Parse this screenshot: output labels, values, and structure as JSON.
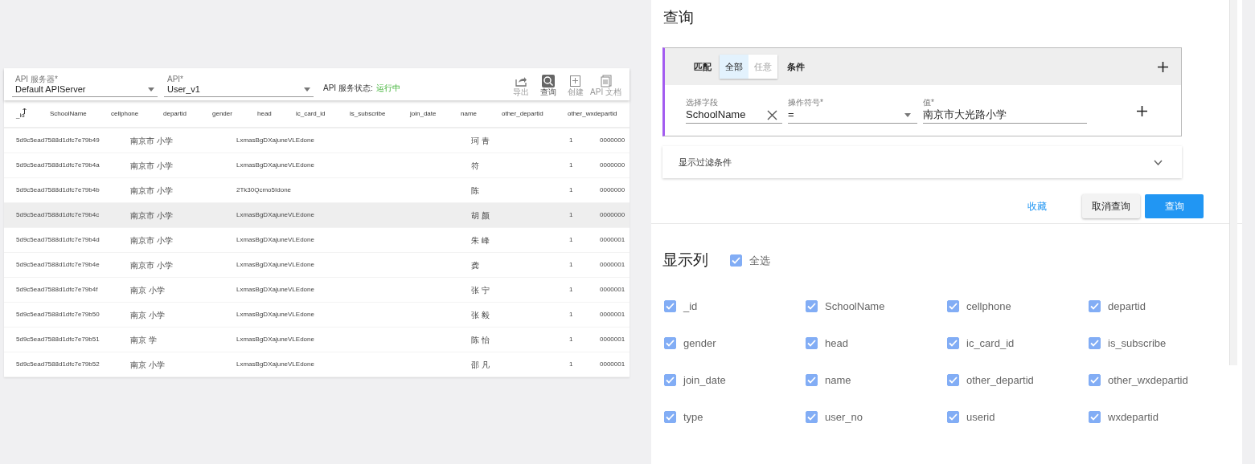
{
  "toolbar": {
    "server": {
      "label": "API 服务器*",
      "value": "Default APIServer"
    },
    "api": {
      "label": "API*",
      "value": "User_v1"
    },
    "status_label": "API 服务状态:",
    "status_value": "运行中",
    "actions": [
      {
        "label": "导出",
        "kind": "export",
        "selected": false
      },
      {
        "label": "查询",
        "kind": "search",
        "selected": true
      },
      {
        "label": "创建",
        "kind": "create",
        "selected": false
      },
      {
        "label": "API 文档",
        "kind": "docs",
        "selected": false
      }
    ]
  },
  "table": {
    "columns": [
      "_id",
      "SchoolName",
      "cellphone",
      "departid",
      "gender",
      "head",
      "ic_card_id",
      "is_subscribe",
      "join_date",
      "name",
      "other_departid",
      "other_wxdepartid"
    ],
    "rows": [
      {
        "id": "5d9c5ead7588d1dfc7e79b49",
        "school": "南京市 小学",
        "head": "LxmasBgDXajuneVLEdone",
        "name": "珂 青",
        "other_departid": "1",
        "other_wxdepartid": "0000000",
        "selected": false
      },
      {
        "id": "5d9c5ead7588d1dfc7e79b4a",
        "school": "南京市 小学",
        "head": "LxmasBgDXajuneVLEdone",
        "name": "符",
        "other_departid": "1",
        "other_wxdepartid": "0000000",
        "selected": false
      },
      {
        "id": "5d9c5ead7588d1dfc7e79b4b",
        "school": "南京市 小学",
        "head": "2Tk30Qcmo5Idone",
        "name": "陈",
        "other_departid": "1",
        "other_wxdepartid": "0000000",
        "selected": false
      },
      {
        "id": "5d9c5ead7588d1dfc7e79b4c",
        "school": "南京市 小学",
        "head": "LxmasBgDXajuneVLEdone",
        "name": "胡 颜",
        "other_departid": "1",
        "other_wxdepartid": "0000000",
        "selected": true
      },
      {
        "id": "5d9c5ead7588d1dfc7e79b4d",
        "school": "南京市 小学",
        "head": "LxmasBgDXajuneVLEdone",
        "name": "朱 峰",
        "other_departid": "1",
        "other_wxdepartid": "0000001",
        "selected": false
      },
      {
        "id": "5d9c5ead7588d1dfc7e79b4e",
        "school": "南京市 小学",
        "head": "LxmasBgDXajuneVLEdone",
        "name": "龚",
        "other_departid": "1",
        "other_wxdepartid": "0000001",
        "selected": false
      },
      {
        "id": "5d9c5ead7588d1dfc7e79b4f",
        "school": "南京 小学",
        "head": "LxmasBgDXajuneVLEdone",
        "name": "张 宁",
        "other_departid": "1",
        "other_wxdepartid": "0000001",
        "selected": false
      },
      {
        "id": "5d9c5ead7588d1dfc7e79b50",
        "school": "南京 小学",
        "head": "LxmasBgDXajuneVLEdone",
        "name": "张 毅",
        "other_departid": "1",
        "other_wxdepartid": "0000001",
        "selected": false
      },
      {
        "id": "5d9c5ead7588d1dfc7e79b51",
        "school": "南京 学",
        "head": "LxmasBgDXajuneVLEdone",
        "name": "陈 怡",
        "other_departid": "1",
        "other_wxdepartid": "0000001",
        "selected": false
      },
      {
        "id": "5d9c5ead7588d1dfc7e79b52",
        "school": "南京 小学",
        "head": "LxmasBgDXajuneVLEdone",
        "name": "邵 凡",
        "other_departid": "1",
        "other_wxdepartid": "0000001",
        "selected": false
      }
    ]
  },
  "query": {
    "title": "查询",
    "match": {
      "label": "匹配",
      "options": [
        {
          "label": "全部",
          "selected": true
        },
        {
          "label": "任意",
          "selected": false
        }
      ],
      "suffix": "条件"
    },
    "condition": {
      "field": {
        "label": "选择字段",
        "value": "SchoolName"
      },
      "operator": {
        "label": "操作符号*",
        "value": "="
      },
      "value": {
        "label": "值*",
        "value": "南京市大光路小学"
      }
    },
    "filter_toggle": {
      "label": "显示过滤条件",
      "expanded": false
    },
    "buttons": [
      {
        "label": "收藏",
        "kind": "link"
      },
      {
        "label": "取消查询",
        "kind": "default"
      },
      {
        "label": "查询",
        "kind": "primary"
      }
    ]
  },
  "columns_section": {
    "title": "显示列",
    "select_all": {
      "label": "全选",
      "checked": true
    },
    "columns": [
      {
        "label": "_id",
        "checked": true
      },
      {
        "label": "SchoolName",
        "checked": true
      },
      {
        "label": "cellphone",
        "checked": true
      },
      {
        "label": "departid",
        "checked": true
      },
      {
        "label": "gender",
        "checked": true
      },
      {
        "label": "head",
        "checked": true
      },
      {
        "label": "ic_card_id",
        "checked": true
      },
      {
        "label": "is_subscribe",
        "checked": true
      },
      {
        "label": "join_date",
        "checked": true
      },
      {
        "label": "name",
        "checked": true
      },
      {
        "label": "other_departid",
        "checked": true
      },
      {
        "label": "other_wxdepartid",
        "checked": true
      },
      {
        "label": "type",
        "checked": true
      },
      {
        "label": "user_no",
        "checked": true
      },
      {
        "label": "userid",
        "checked": true
      },
      {
        "label": "wxdepartid",
        "checked": true
      }
    ]
  }
}
